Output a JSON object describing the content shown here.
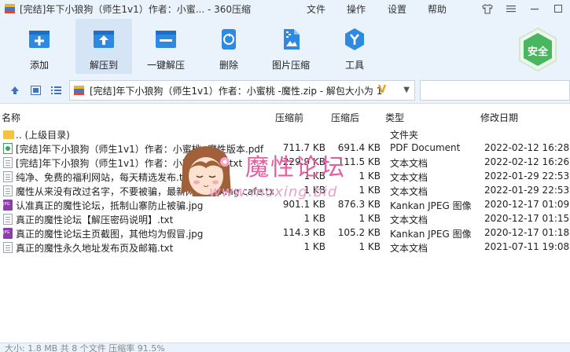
{
  "window": {
    "title": "[完结]年下小狼狗（师生1v1）作者：小蜜... - 360压缩",
    "menu": [
      "文件",
      "操作",
      "设置",
      "帮助"
    ]
  },
  "toolbar": {
    "items": [
      {
        "label": "添加",
        "icon": "add-icon"
      },
      {
        "label": "解压到",
        "icon": "extract-to-icon"
      },
      {
        "label": "一键解压",
        "icon": "one-click-extract-icon"
      },
      {
        "label": "删除",
        "icon": "recycle-icon"
      },
      {
        "label": "图片压缩",
        "icon": "image-compress-icon"
      },
      {
        "label": "工具",
        "icon": "tools-icon"
      }
    ],
    "safe_label": "安全"
  },
  "pathbar": {
    "path": "[完结]年下小狼狗（师生1v1）作者：小蜜桃 -魔性.zip - 解包大小为 1"
  },
  "columns": {
    "name": "名称",
    "size": "压缩前",
    "compressed": "压缩后",
    "type": "类型",
    "modified": "修改日期"
  },
  "rows": [
    {
      "name": ".. (上级目录)",
      "size": "",
      "compressed": "",
      "type": "文件夹",
      "date": "",
      "icon": "folder"
    },
    {
      "name": "[完结]年下小狼狗（师生1v1）作者：小蜜桃 -魔性版本.pdf",
      "size": "711.7 KB",
      "compressed": "691.4 KB",
      "type": "PDF Document",
      "date": "2022-02-12 16:28",
      "icon": "pdf"
    },
    {
      "name": "[完结]年下小狼狗（师生1v1）作者：小蜜桃 -魔性.txt",
      "size": "229.9 KB",
      "compressed": "111.5 KB",
      "type": "文本文档",
      "date": "2022-02-12 16:26",
      "icon": "txt"
    },
    {
      "name": "纯净、免费的福利网站，每天精选发布.txt",
      "size": "1 KB",
      "compressed": "1 KB",
      "type": "文本文档",
      "date": "2022-01-29 22:53",
      "icon": "txt"
    },
    {
      "name": "魔性从来没有改过名字，不要被骗，最新网址moxing.cafe.txt",
      "size": "1 KB",
      "compressed": "1 KB",
      "type": "文本文档",
      "date": "2022-01-29 22:53",
      "icon": "txt"
    },
    {
      "name": "认准真正的魔性论坛，抵制山寨防止被骗.jpg",
      "size": "901.1 KB",
      "compressed": "876.3 KB",
      "type": "Kankan JPEG 图像",
      "date": "2020-12-17 01:09",
      "icon": "jpg"
    },
    {
      "name": "真正的魔性论坛【解压密码说明】.txt",
      "size": "1 KB",
      "compressed": "1 KB",
      "type": "文本文档",
      "date": "2020-12-17 01:15",
      "icon": "txt"
    },
    {
      "name": "真正的魔性论坛主页截图，其他均为假冒.jpg",
      "size": "114.3 KB",
      "compressed": "105.2 KB",
      "type": "Kankan JPEG 图像",
      "date": "2020-12-17 01:18",
      "icon": "jpg"
    },
    {
      "name": "真正的魔性永久地址发布页及邮箱.txt",
      "size": "1 KB",
      "compressed": "1 KB",
      "type": "文本文档",
      "date": "2021-07-11 19:08",
      "icon": "txt"
    }
  ],
  "status": "大小: 1.8 MB 共 8 个文件 压缩率 91.5%",
  "watermark": {
    "title": "魔性论坛",
    "url": "www.moxing.bid"
  },
  "colors": {
    "accent": "#3b8de0",
    "chrome": "#eaf2fb",
    "safe_green": "#49b75d",
    "watermark": "#e55fa0"
  }
}
